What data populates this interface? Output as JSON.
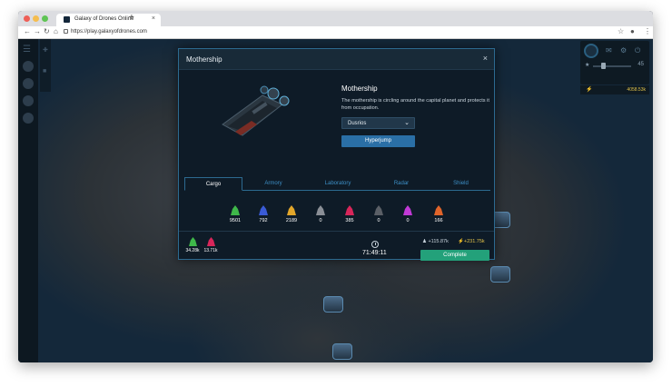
{
  "browser": {
    "tab_title": "Galaxy of Drones Online",
    "new_tab": "+",
    "tab_close": "×",
    "url": "https://play.galaxyofdrones.com",
    "colors": {
      "close": "#ee5f57",
      "minimize": "#f5bd4f",
      "maximize": "#5fc454"
    }
  },
  "hud": {
    "zoom_value": "45",
    "energy_value": "4058.53k",
    "slider_level": 0.25
  },
  "modal": {
    "title": "Mothership",
    "close_icon": "×",
    "info_title": "Mothership",
    "description": "The mothership is circling around the capital planet and protects it from occupation.",
    "planet_select": "Dusrios",
    "hyperjump_label": "Hyperjump",
    "tabs": [
      {
        "label": "Cargo",
        "active": true
      },
      {
        "label": "Armory",
        "active": false
      },
      {
        "label": "Laboratory",
        "active": false
      },
      {
        "label": "Radar",
        "active": false
      },
      {
        "label": "Shield",
        "active": false
      }
    ],
    "resources": [
      {
        "value": "9501",
        "color": "#3fb84a"
      },
      {
        "value": "792",
        "color": "#3a5bd6"
      },
      {
        "value": "2189",
        "color": "#e2a62a"
      },
      {
        "value": "0",
        "color": "#8a8f96"
      },
      {
        "value": "385",
        "color": "#d8265a"
      },
      {
        "value": "0",
        "color": "#5a5f66"
      },
      {
        "value": "0",
        "color": "#c13ad6"
      },
      {
        "value": "166",
        "color": "#e0642a"
      }
    ],
    "footer": {
      "cargo": [
        {
          "value": "34.28k",
          "color": "#3fb84a"
        },
        {
          "value": "13.71k",
          "color": "#d8265a"
        }
      ],
      "timer": "71:49:11",
      "earn_people": "+115.87k",
      "earn_energy": "+231.75k",
      "complete_label": "Complete"
    }
  }
}
